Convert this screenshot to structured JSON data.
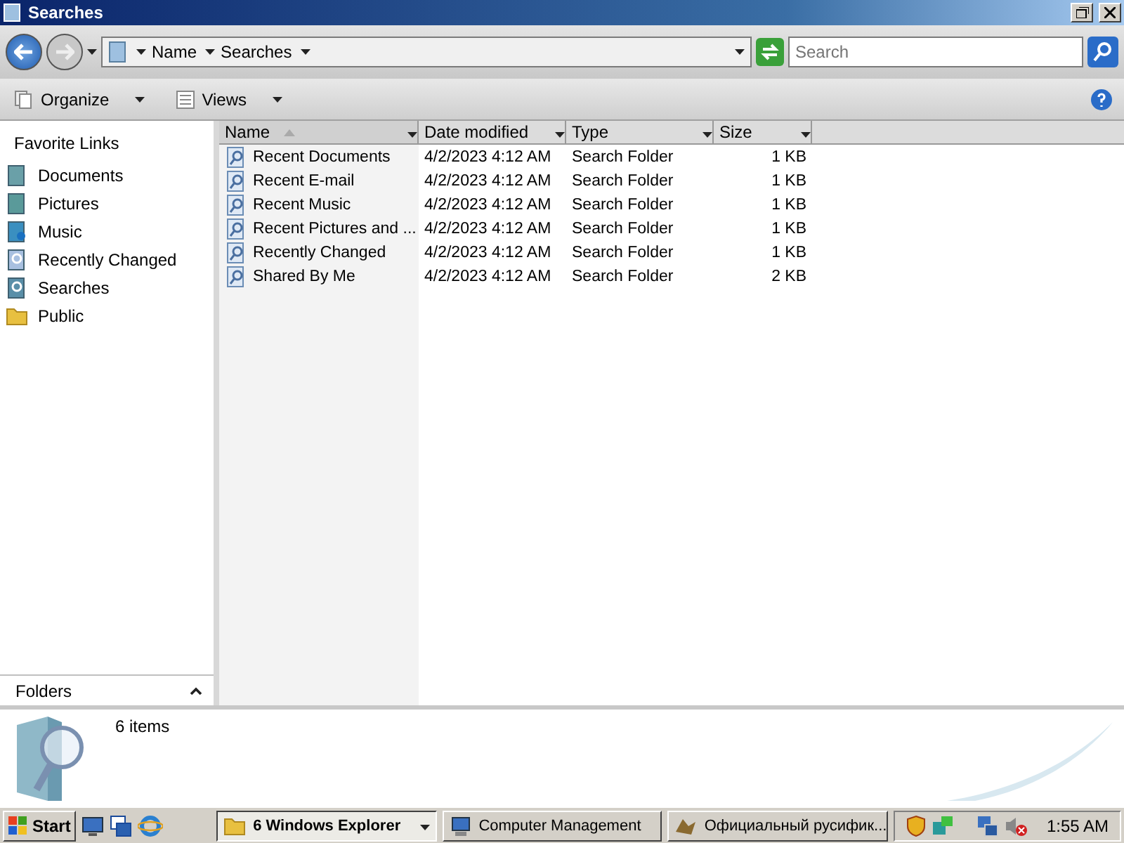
{
  "window": {
    "title": "Searches"
  },
  "address": {
    "crumbs": [
      "Name",
      "Searches"
    ],
    "search_placeholder": "Search"
  },
  "toolbar": [
    "Organize",
    "Views"
  ],
  "favorites": {
    "title": "Favorite Links",
    "items": [
      {
        "label": "Documents",
        "kind": "documents"
      },
      {
        "label": "Pictures",
        "kind": "pictures"
      },
      {
        "label": "Music",
        "kind": "music"
      },
      {
        "label": "Recently Changed",
        "kind": "search"
      },
      {
        "label": "Searches",
        "kind": "searches"
      },
      {
        "label": "Public",
        "kind": "folder"
      }
    ]
  },
  "columns": [
    {
      "label": "Name",
      "sorted": true
    },
    {
      "label": "Date modified",
      "sorted": false
    },
    {
      "label": "Type",
      "sorted": false
    },
    {
      "label": "Size",
      "sorted": false
    }
  ],
  "rows": [
    [
      "Recent Documents",
      "4/2/2023 4:12 AM",
      "Search Folder",
      "1 KB"
    ],
    [
      "Recent E-mail",
      "4/2/2023 4:12 AM",
      "Search Folder",
      "1 KB"
    ],
    [
      "Recent Music",
      "4/2/2023 4:12 AM",
      "Search Folder",
      "1 KB"
    ],
    [
      "Recent Pictures and ...",
      "4/2/2023 4:12 AM",
      "Search Folder",
      "1 KB"
    ],
    [
      "Recently Changed",
      "4/2/2023 4:12 AM",
      "Search Folder",
      "1 KB"
    ],
    [
      "Shared By Me",
      "4/2/2023 4:12 AM",
      "Search Folder",
      "2 KB"
    ]
  ],
  "folders_label": "Folders",
  "details": "6 items",
  "taskbar": {
    "start": "Start",
    "tasks": [
      {
        "label": "6 Windows Explorer",
        "kind": "folder",
        "selected": true
      },
      {
        "label": "Computer Management",
        "kind": "computer",
        "selected": false
      },
      {
        "label": "Официальный русифик...",
        "kind": "app",
        "selected": false
      }
    ],
    "clock": "1:55 AM"
  }
}
